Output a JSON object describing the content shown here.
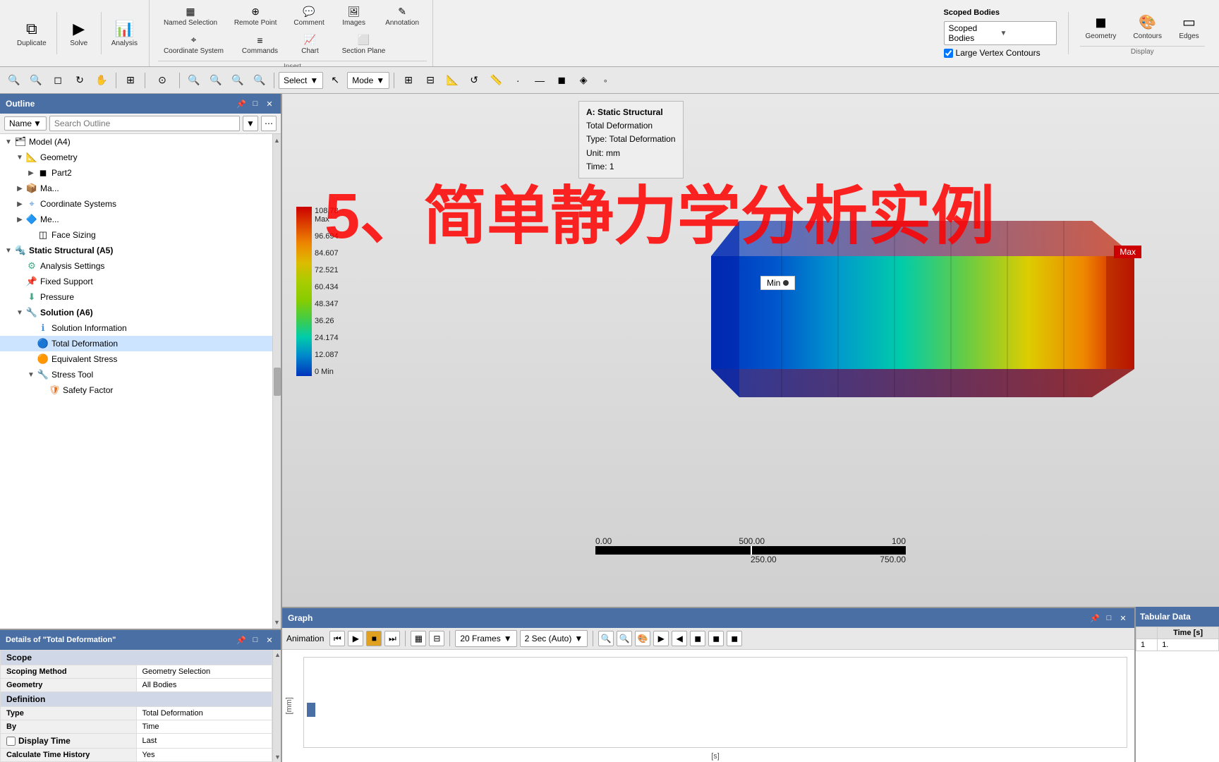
{
  "toolbar": {
    "buttons": [
      {
        "id": "duplicate",
        "label": "Duplicate",
        "icon": "⧉"
      },
      {
        "id": "solve",
        "label": "Solve",
        "icon": "▶"
      },
      {
        "id": "analysis",
        "label": "Analysis",
        "icon": "📊"
      }
    ],
    "insert_label": "Insert",
    "insert_items": [
      {
        "id": "named-selection",
        "label": "Named Selection",
        "icon": "▦"
      },
      {
        "id": "remote-point",
        "label": "Remote Point",
        "icon": "⊕"
      },
      {
        "id": "comment",
        "label": "Comment",
        "icon": "💬"
      },
      {
        "id": "images",
        "label": "Images",
        "icon": "🖼"
      },
      {
        "id": "annotation",
        "label": "Annotation",
        "icon": "✎"
      },
      {
        "id": "coordinate-system",
        "label": "Coordinate System",
        "icon": "⌖"
      },
      {
        "id": "commands",
        "label": "Commands",
        "icon": "≡"
      },
      {
        "id": "chart",
        "label": "Chart",
        "icon": "📈"
      },
      {
        "id": "section-plane",
        "label": "Section Plane",
        "icon": "⬜"
      }
    ],
    "scoped_bodies_label": "Scoped Bodies",
    "large_vertex_label": "Large Vertex Contours",
    "display_label": "Display",
    "geometry_label": "Geometry",
    "contours_label": "Contours",
    "edges_label": "Edges"
  },
  "outline": {
    "panel_title": "Outline",
    "name_dropdown": "Name",
    "search_placeholder": "Search Outline",
    "tree": [
      {
        "id": "model",
        "label": "Model (A4)",
        "level": 0,
        "icon": "🗂",
        "expanded": true,
        "type": "folder"
      },
      {
        "id": "geometry",
        "label": "Geometry",
        "level": 1,
        "icon": "📐",
        "expanded": true,
        "type": "folder"
      },
      {
        "id": "part2",
        "label": "Part2",
        "level": 2,
        "icon": "◼",
        "expanded": false,
        "type": "part"
      },
      {
        "id": "materials",
        "label": "Ma...",
        "level": 1,
        "icon": "📦",
        "expanded": false,
        "type": "folder"
      },
      {
        "id": "coord",
        "label": "Coordinate Systems",
        "level": 1,
        "icon": "⌖",
        "expanded": false,
        "type": "folder"
      },
      {
        "id": "mesh",
        "label": "Me...",
        "level": 1,
        "icon": "🔷",
        "expanded": false,
        "type": "folder"
      },
      {
        "id": "face-sizing",
        "label": "Face Sizing",
        "level": 2,
        "icon": "◫",
        "expanded": false,
        "type": "item"
      },
      {
        "id": "static-structural",
        "label": "Static Structural (A5)",
        "level": 0,
        "icon": "🔩",
        "expanded": true,
        "type": "folder"
      },
      {
        "id": "analysis-settings",
        "label": "Analysis Settings",
        "level": 1,
        "icon": "⚙",
        "expanded": false,
        "type": "item"
      },
      {
        "id": "fixed-support",
        "label": "Fixed Support",
        "level": 1,
        "icon": "📌",
        "expanded": false,
        "type": "item"
      },
      {
        "id": "pressure",
        "label": "Pressure",
        "level": 1,
        "icon": "⬇",
        "expanded": false,
        "type": "item"
      },
      {
        "id": "solution",
        "label": "Solution (A6)",
        "level": 1,
        "icon": "🔧",
        "expanded": true,
        "type": "folder"
      },
      {
        "id": "solution-info",
        "label": "Solution Information",
        "level": 2,
        "icon": "ℹ",
        "expanded": false,
        "type": "item"
      },
      {
        "id": "total-deformation",
        "label": "Total Deformation",
        "level": 2,
        "icon": "🔵",
        "expanded": false,
        "type": "item",
        "selected": true
      },
      {
        "id": "equivalent-stress",
        "label": "Equivalent Stress",
        "level": 2,
        "icon": "🟠",
        "expanded": false,
        "type": "item"
      },
      {
        "id": "stress-tool",
        "label": "Stress Tool",
        "level": 2,
        "icon": "🔧",
        "expanded": true,
        "type": "folder"
      },
      {
        "id": "safety-factor",
        "label": "Safety Factor",
        "level": 3,
        "icon": "🛡",
        "expanded": false,
        "type": "item"
      }
    ]
  },
  "details": {
    "panel_title": "Details of \"Total Deformation\"",
    "scroll_up": "▲",
    "sections": [
      {
        "header": "Scope",
        "rows": [
          {
            "label": "Scoping Method",
            "value": "Geometry Selection"
          },
          {
            "label": "Geometry",
            "value": "All Bodies"
          }
        ]
      },
      {
        "header": "Definition",
        "rows": [
          {
            "label": "Type",
            "value": "Total Deformation"
          },
          {
            "label": "By",
            "value": "Time"
          },
          {
            "label": "Display Time",
            "value": "Last",
            "checkbox": true
          },
          {
            "label": "Calculate Time History",
            "value": "Yes"
          }
        ]
      }
    ]
  },
  "viewport": {
    "title": "A: Static Structural",
    "subtitle": "Total Deformation",
    "type_label": "Type: Total Deformation",
    "unit_label": "Unit: mm",
    "time_label": "Time: 1",
    "legend": {
      "values": [
        {
          "label": "108.78 Max",
          "color": "#cc0000"
        },
        {
          "label": "96.694",
          "color": "#dd4400"
        },
        {
          "label": "84.607",
          "color": "#ee8800"
        },
        {
          "label": "72.521",
          "color": "#ddbb00"
        },
        {
          "label": "60.434",
          "color": "#bbcc00"
        },
        {
          "label": "48.347",
          "color": "#88cc00"
        },
        {
          "label": "36.26",
          "color": "#44cc44"
        },
        {
          "label": "24.174",
          "color": "#00ccaa"
        },
        {
          "label": "12.087",
          "color": "#0088cc"
        },
        {
          "label": "0 Min",
          "color": "#0044bb"
        }
      ]
    },
    "min_label": "Min",
    "max_label": "Max",
    "scale": {
      "top_values": [
        "0.00",
        "500.00",
        "100"
      ],
      "mid_values": [
        "250.00",
        "750.00"
      ]
    },
    "watermark": "5、简单静力学分析实例"
  },
  "graph": {
    "panel_title": "Graph",
    "animation_label": "Animation",
    "frames_label": "20 Frames",
    "sec_label": "2 Sec (Auto)",
    "y_label": "[mm]",
    "x_label": "[s]"
  },
  "tabular": {
    "panel_title": "Tabular Data",
    "col_time": "Time [s]",
    "rows": [
      {
        "num": "1",
        "time": "1."
      }
    ]
  }
}
